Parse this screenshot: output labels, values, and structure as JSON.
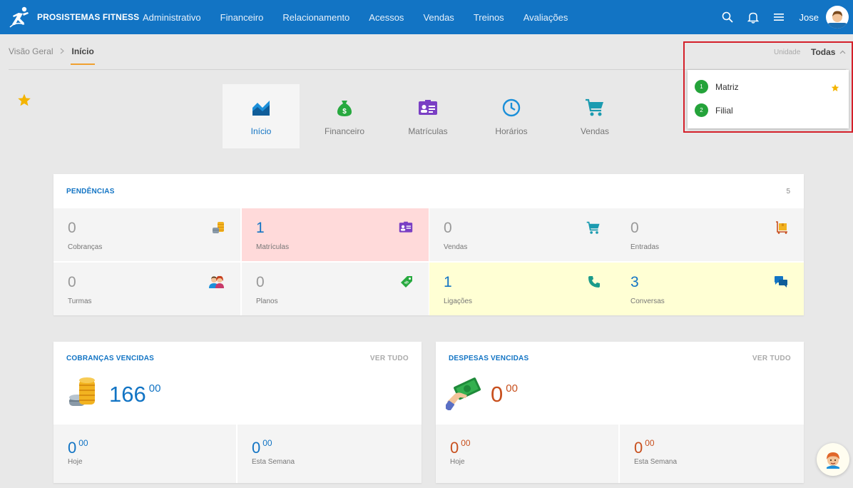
{
  "app": {
    "brand": "PROSISTEMAS FITNESS"
  },
  "nav": [
    "Administrativo",
    "Financeiro",
    "Relacionamento",
    "Acessos",
    "Vendas",
    "Treinos",
    "Avaliações"
  ],
  "user": {
    "name": "Jose"
  },
  "breadcrumb": {
    "parent": "Visão Geral",
    "current": "Início"
  },
  "unit_selector": {
    "label": "Unidade",
    "value": "Todas",
    "options": [
      {
        "number": "1",
        "name": "Matriz",
        "favorite": true
      },
      {
        "number": "2",
        "name": "Filial",
        "favorite": false
      }
    ]
  },
  "quick_tabs": [
    {
      "label": "Início",
      "icon": "area-chart-icon",
      "active": true
    },
    {
      "label": "Financeiro",
      "icon": "money-bag-icon",
      "active": false
    },
    {
      "label": "Matrículas",
      "icon": "id-card-icon",
      "active": false
    },
    {
      "label": "Horários",
      "icon": "clock-icon",
      "active": false
    },
    {
      "label": "Vendas",
      "icon": "cart-icon",
      "active": false
    }
  ],
  "pendencias": {
    "title": "PENDÊNCIAS",
    "count": "5",
    "tiles": [
      {
        "value": "0",
        "label": "Cobranças",
        "icon": "coins-icon"
      },
      {
        "value": "1",
        "label": "Matrículas",
        "icon": "id-card-icon"
      },
      {
        "value": "0",
        "label": "Vendas",
        "icon": "cart-icon"
      },
      {
        "value": "0",
        "label": "Entradas",
        "icon": "box-cart-icon"
      },
      {
        "value": "0",
        "label": "Turmas",
        "icon": "people-icon"
      },
      {
        "value": "0",
        "label": "Planos",
        "icon": "tag-icon"
      },
      {
        "value": "1",
        "label": "Ligações",
        "icon": "phone-icon"
      },
      {
        "value": "3",
        "label": "Conversas",
        "icon": "chat-icon"
      }
    ]
  },
  "cobrancas": {
    "title": "COBRANÇAS VENCIDAS",
    "see_all": "VER TUDO",
    "value": "166",
    "cents": "00",
    "today": {
      "value": "0",
      "cents": "00",
      "label": "Hoje"
    },
    "week": {
      "value": "0",
      "cents": "00",
      "label": "Esta Semana"
    }
  },
  "despesas": {
    "title": "DESPESAS VENCIDAS",
    "see_all": "VER TUDO",
    "value": "0",
    "cents": "00",
    "today": {
      "value": "0",
      "cents": "00",
      "label": "Hoje"
    },
    "week": {
      "value": "0",
      "cents": "00",
      "label": "Esta Semana"
    }
  },
  "colors": {
    "primary": "#1274c4",
    "accent": "#f0a030",
    "danger": "#d4202a",
    "success": "#24a33a",
    "expense": "#c8501e"
  }
}
